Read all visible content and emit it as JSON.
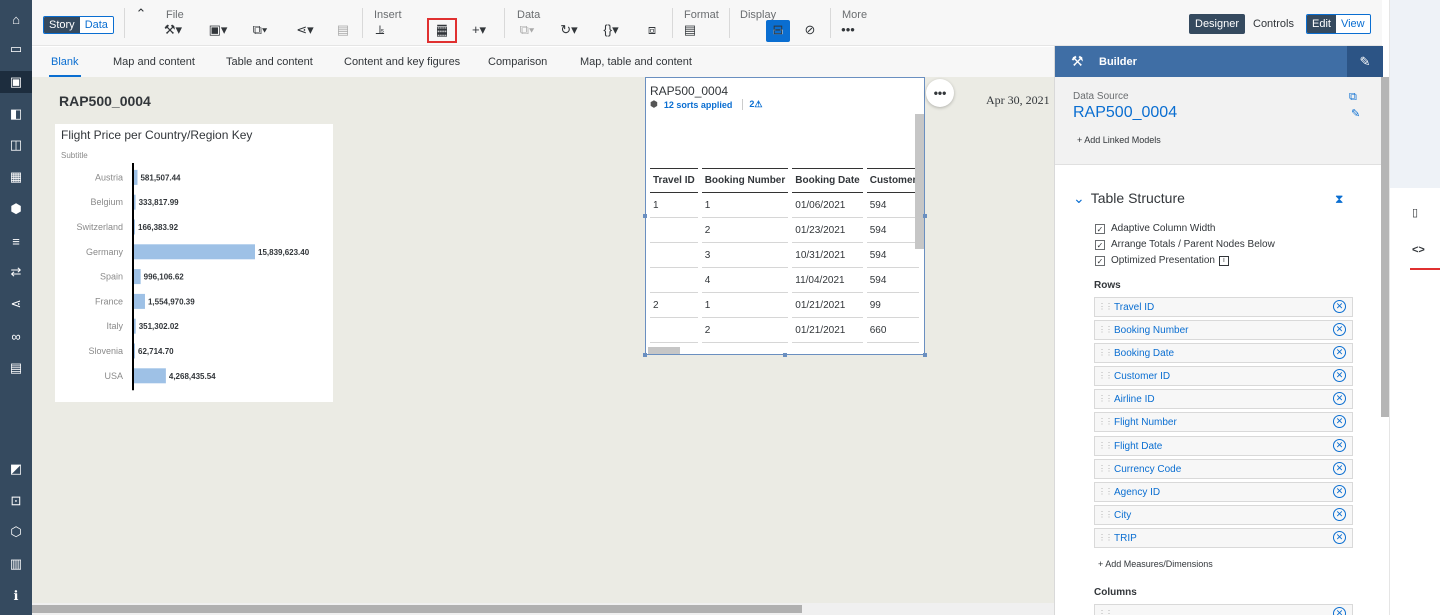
{
  "toolbar": {
    "mode_tabs": [
      "Story",
      "Data"
    ],
    "groups": {
      "file": "File",
      "insert": "Insert",
      "data": "Data",
      "format": "Format",
      "display": "Display",
      "more": "More"
    },
    "more_glyph": "•••",
    "designer": "Designer",
    "controls": "Controls",
    "edit": "Edit",
    "view": "View"
  },
  "page_tabs": [
    "Blank",
    "Map and content",
    "Table and content",
    "Content and key figures",
    "Comparison",
    "Map, table and content"
  ],
  "story": {
    "title": "RAP500_0004",
    "date": "Apr 30, 2021"
  },
  "chart_data": {
    "type": "bar",
    "orientation": "horizontal",
    "title": "Flight Price per Country/Region Key",
    "subtitle": "Subtitle",
    "categories": [
      "Austria",
      "Belgium",
      "Switzerland",
      "Germany",
      "Spain",
      "France",
      "Italy",
      "Slovenia",
      "USA"
    ],
    "values": [
      581507.44,
      333817.99,
      166383.92,
      15839623.4,
      996106.62,
      1554970.39,
      351302.02,
      62714.7,
      4268435.54
    ],
    "labels": [
      "581,507.44",
      "333,817.99",
      "166,383.92",
      "15,839,623.40",
      "996,106.62",
      "1,554,970.39",
      "351,302.02",
      "62,714.70",
      "4,268,435.54"
    ],
    "xlim": [
      0,
      15839623.4
    ],
    "bar_color": "#9ec1e6"
  },
  "table_widget": {
    "title": "RAP500_0004",
    "sorts": "12 sorts applied",
    "warnings": "2",
    "columns": [
      "Travel ID",
      "Booking Number",
      "Booking Date",
      "Customer"
    ],
    "rows": [
      [
        "1",
        "1",
        "01/06/2021",
        "594"
      ],
      [
        "",
        "2",
        "01/23/2021",
        "594"
      ],
      [
        "",
        "3",
        "10/31/2021",
        "594"
      ],
      [
        "",
        "4",
        "11/04/2021",
        "594"
      ],
      [
        "2",
        "1",
        "01/21/2021",
        "99"
      ],
      [
        "",
        "2",
        "01/21/2021",
        "660"
      ]
    ],
    "more_glyph": "•••"
  },
  "builder": {
    "title": "Builder",
    "data_source_label": "Data Source",
    "data_source": "RAP500_0004",
    "add_linked_models": "+ Add Linked Models",
    "table_structure": "Table Structure",
    "options": [
      "Adaptive Column Width",
      "Arrange Totals / Parent Nodes Below",
      "Optimized Presentation"
    ],
    "rows_label": "Rows",
    "rows": [
      "Travel ID",
      "Booking Number",
      "Booking Date",
      "Customer ID",
      "Airline ID",
      "Flight Number",
      "Flight Date",
      "Currency Code",
      "Agency ID",
      "City",
      "TRIP"
    ],
    "add_measures": "+ Add Measures/Dimensions",
    "columns_label": "Columns"
  },
  "colors": {
    "nav": "#354a5f",
    "accent": "#0a6ed1",
    "builder_header": "#3f6ea5",
    "highlight": "#e03030"
  }
}
